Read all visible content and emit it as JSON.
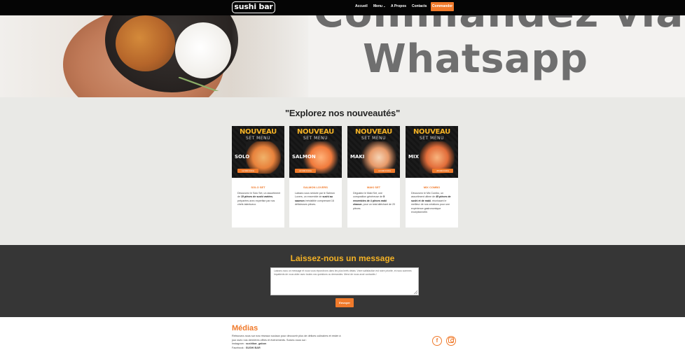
{
  "nav": {
    "logo": "sushi bar",
    "items": [
      {
        "label": "Accueil"
      },
      {
        "label": "Menu",
        "caret": "⌄"
      },
      {
        "label": "A Propos"
      },
      {
        "label": "Contacts"
      }
    ],
    "cta": "Commander"
  },
  "hero": {
    "top_text": "Commandez via",
    "main_text": "Whatsapp"
  },
  "news": {
    "title": "\"Explorez nos nouveautés\"",
    "cards": [
      {
        "img_title": "NOUVEAU",
        "img_subtitle": "SET MENU",
        "img_dish": "SOLO",
        "img_price": "12 000 FCFA",
        "name": "SOLO SET",
        "desc_pre": "Découvrez le Solo Set, un assortiment de ",
        "desc_bold": "15 pièces de sushi variées",
        "desc_post": ", préparées avec expertise par nos chefs talentueux."
      },
      {
        "img_title": "NOUVEAU",
        "img_subtitle": "SET MENU",
        "img_dish": "SALMON",
        "img_price": "22 000 FCFA",
        "name": "SALMON LOVERS",
        "desc_pre": "Laissez-vous séduire par le Salmon Lovers, un ensemble de ",
        "desc_bold": "sushi au saumon",
        "desc_post": " irrésistible comprenant 16 délicieuses pièces."
      },
      {
        "img_title": "NOUVEAU",
        "img_subtitle": "SET MENU",
        "img_dish": "MAKI",
        "img_price": "13 000 FCFA",
        "name": "MAKI SET",
        "desc_pre": "Dégustez le Maki Set, une composition généreuse de ",
        "desc_bold": "5 ensembles de 4 pièces maki chacun",
        "desc_post": ", pour un total alléchant de 20 pièces."
      },
      {
        "img_title": "NOUVEAU",
        "img_subtitle": "SET MENU",
        "img_dish": "MIX",
        "img_price": "45 000 FCFA",
        "name": "MIX COMBO",
        "desc_pre": "Découvrez le Mix Combo, un assortiment ultime de ",
        "desc_bold": "45 pièces de sushi et de maki",
        "desc_post": ", réunissant le meilleur de nos créations pour une expérience gastronomique exceptionnelle."
      }
    ]
  },
  "message": {
    "title": "Laissez-nous un message",
    "text": "Laissez-nous un message et nous vous répondrons dans les plus brefs délais. Votre satisfaction est notre priorité, et nous sommes impatients de vous aider avec toutes vos questions ou demandes. Merci de nous avoir contactés !",
    "button": "Envoyer"
  },
  "footer": {
    "title": "Médias",
    "text": "Retrouvez-nous sur nos réseaux sociaux pour découvrir plus de délices culinaires et rester à jour avec nos dernières offres et événements. Suivez-nous sur :",
    "instagram_label": "Instagram : ",
    "instagram_handle": "sushibar_gabon",
    "facebook_label": "Facebook : ",
    "facebook_handle": "SUSHI BAR",
    "facebook_icon": "f"
  },
  "colors": {
    "accent": "#f07a2b",
    "yellow": "#f4b225",
    "dark": "#363636",
    "nav": "#050505"
  }
}
